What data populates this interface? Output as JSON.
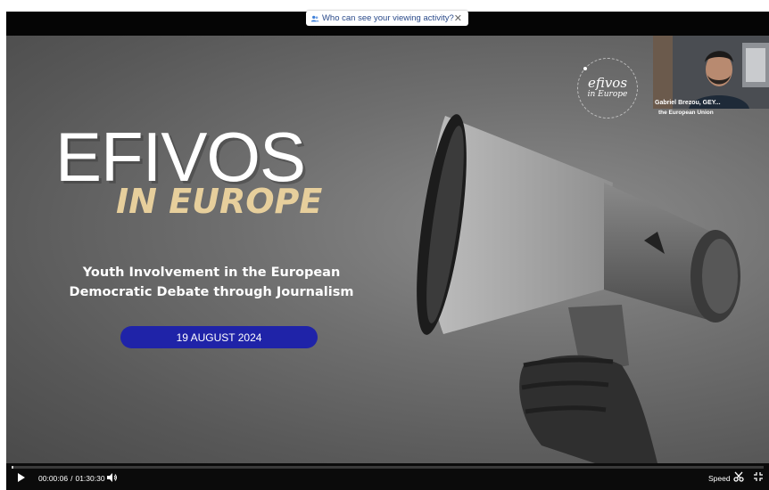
{
  "notice": {
    "text": "Who can see your viewing activity?",
    "close": "✕"
  },
  "slide": {
    "title_line1": "EFIVOS",
    "title_line2": "IN EUROPE",
    "subtitle_line1": "Youth Involvement in the European",
    "subtitle_line2": "Democratic Debate through Journalism",
    "date": "19 AUGUST 2024",
    "logo_line1": "efivos",
    "logo_line2": "in Europe"
  },
  "camera": {
    "name": "Gabriel Brezou, GEY...",
    "caption": "the European Union"
  },
  "controls": {
    "time_current": "00:00:06",
    "time_separator": "/",
    "time_total": "01:30:30",
    "speed_label": "Speed",
    "progress_fraction": 0.001
  },
  "colors": {
    "date_pill": "#1f23a8",
    "title_accent": "#e7cf9c"
  }
}
